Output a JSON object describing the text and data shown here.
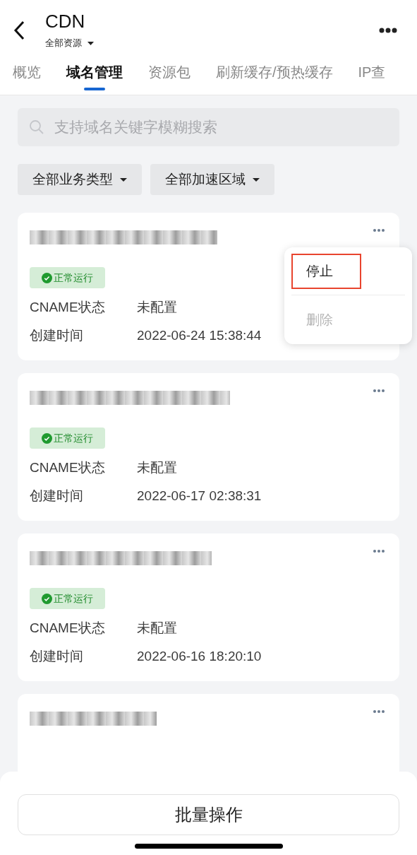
{
  "header": {
    "title": "CDN",
    "scope": "全部资源"
  },
  "tabs": [
    {
      "label": "概览",
      "selected": false
    },
    {
      "label": "域名管理",
      "selected": true
    },
    {
      "label": "资源包",
      "selected": false
    },
    {
      "label": "刷新缓存/预热缓存",
      "selected": false
    },
    {
      "label": "IP查",
      "selected": false
    }
  ],
  "search": {
    "placeholder": "支持域名关键字模糊搜索"
  },
  "filters": [
    "全部业务类型",
    "全部加速区域"
  ],
  "domains": [
    {
      "kind": "full",
      "status": "正常运行",
      "rows": [
        {
          "label": "CNAME状态",
          "value": "未配置"
        },
        {
          "label": "创建时间",
          "value": "2022-06-24 15:38:44"
        }
      ],
      "menu": [
        {
          "label": "停止",
          "disabled": false,
          "highlighted": true
        },
        {
          "label": "删除",
          "disabled": true,
          "highlighted": false
        }
      ]
    },
    {
      "kind": "full",
      "status": "正常运行",
      "rows": [
        {
          "label": "CNAME状态",
          "value": "未配置"
        },
        {
          "label": "创建时间",
          "value": "2022-06-17 02:38:31"
        }
      ]
    },
    {
      "kind": "full",
      "status": "正常运行",
      "rows": [
        {
          "label": "CNAME状态",
          "value": "未配置"
        },
        {
          "label": "创建时间",
          "value": "2022-06-16 18:20:10"
        }
      ]
    },
    {
      "kind": "covered"
    }
  ],
  "bottom_button": "批量操作"
}
